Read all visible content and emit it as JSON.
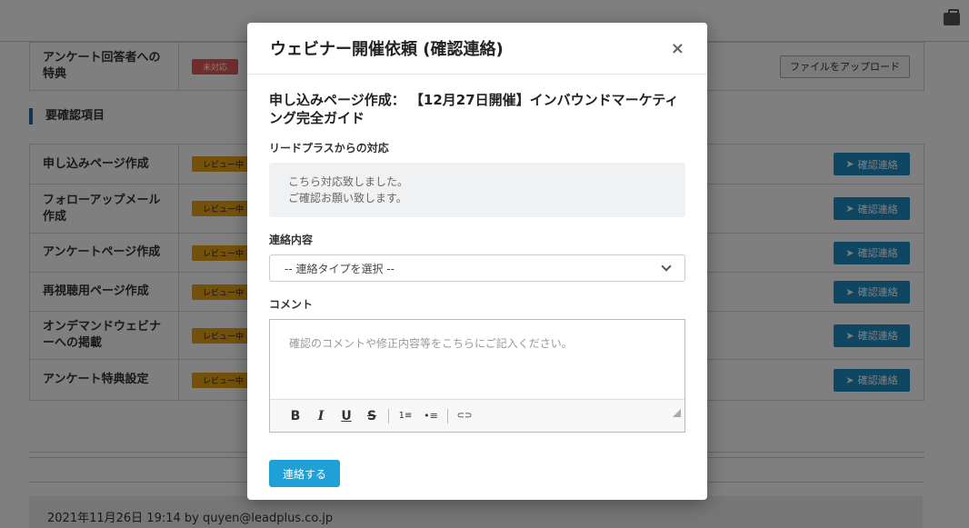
{
  "background": {
    "rows_top": [
      {
        "label": "アンケート回答者への特典",
        "status": "未対応",
        "status_color": "#e05a5a",
        "button": "ファイルをアップロード"
      }
    ],
    "section_title": "要確認項目",
    "rows": [
      {
        "label": "申し込みページ作成",
        "status": "レビュー中",
        "button": "確認連絡"
      },
      {
        "label": "フォローアップメール作成",
        "status": "レビュー中",
        "button": "確認連絡"
      },
      {
        "label": "アンケートページ作成",
        "status": "レビュー中",
        "button": "確認連絡"
      },
      {
        "label": "再視聴用ページ作成",
        "status": "レビュー中",
        "button": "確認連絡"
      },
      {
        "label": "オンデマンドウェビナーへの掲載",
        "status": "レビュー中",
        "button": "確認連絡"
      },
      {
        "label": "アンケート特典設定",
        "status": "レビュー中",
        "button": "確認連絡"
      }
    ],
    "footer_text": "2021年11月26日 19:14 by quyen@leadplus.co.jp"
  },
  "modal": {
    "title": "ウェビナー開催依頼 (確認連絡)",
    "close": "×",
    "subject": "申し込みページ作成： 【12月27日開催】インバウンドマーケティング完全ガイド",
    "reply_label": "リードプラスからの対応",
    "reply_lines": [
      "こちら対応致しました。",
      "ご確認お願い致します。"
    ],
    "contact_label": "連絡内容",
    "contact_select": "-- 連絡タイプを選択 --",
    "comment_label": "コメント",
    "comment_placeholder": "確認のコメントや修正内容等をこちらにご記入ください。",
    "toolbar": {
      "bold": "B",
      "italic": "I",
      "underline": "U",
      "strike": "S",
      "ol": "1≡",
      "ul": "•≡",
      "link": "⊂⊃"
    },
    "submit_label": "連絡する"
  },
  "colors": {
    "accent": "#1fa0d6",
    "confirm_button": "#1f8cc4",
    "status_review": "#e8a317",
    "status_open": "#e05a5a"
  }
}
